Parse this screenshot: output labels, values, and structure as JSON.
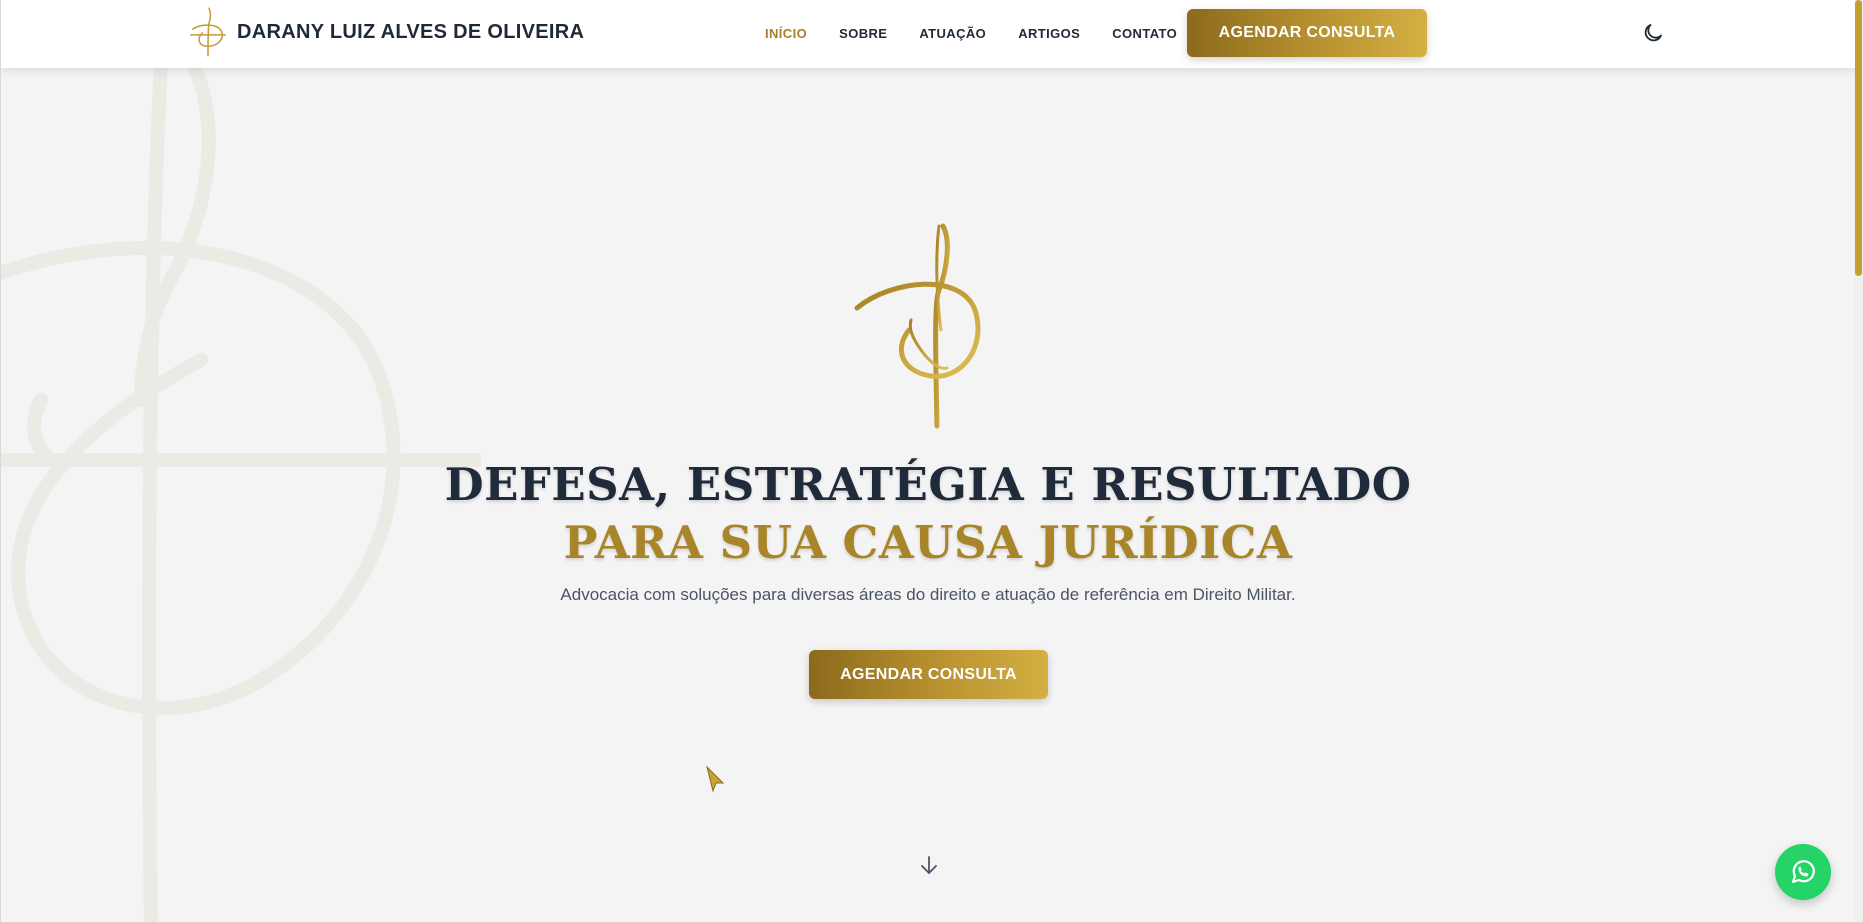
{
  "header": {
    "brand_name": "DARANY LUIZ ALVES DE OLIVEIRA",
    "nav": [
      {
        "label": "INÍCIO",
        "active": true
      },
      {
        "label": "SOBRE",
        "active": false
      },
      {
        "label": "ATUAÇÃO",
        "active": false
      },
      {
        "label": "ARTIGOS",
        "active": false
      },
      {
        "label": "CONTATO",
        "active": false
      }
    ],
    "cta_label": "AGENDAR CONSULTA"
  },
  "hero": {
    "title_line1": "DEFESA, ESTRATÉGIA E RESULTADO",
    "title_line2": "PARA SUA CAUSA JURÍDICA",
    "subtitle": "Advocacia com soluções para diversas áreas do direito e atuação de referência em Direito Militar.",
    "cta_label": "AGENDAR CONSULTA"
  },
  "icons": {
    "logo": "monogram-logo-icon",
    "theme": "moon-icon",
    "scroll": "arrow-down-icon",
    "whatsapp": "whatsapp-icon"
  },
  "colors": {
    "gold": "#a9852a",
    "gold_light": "#d4b043",
    "navy": "#1f2a3a",
    "background": "#f4f4f4",
    "whatsapp": "#25d366"
  }
}
